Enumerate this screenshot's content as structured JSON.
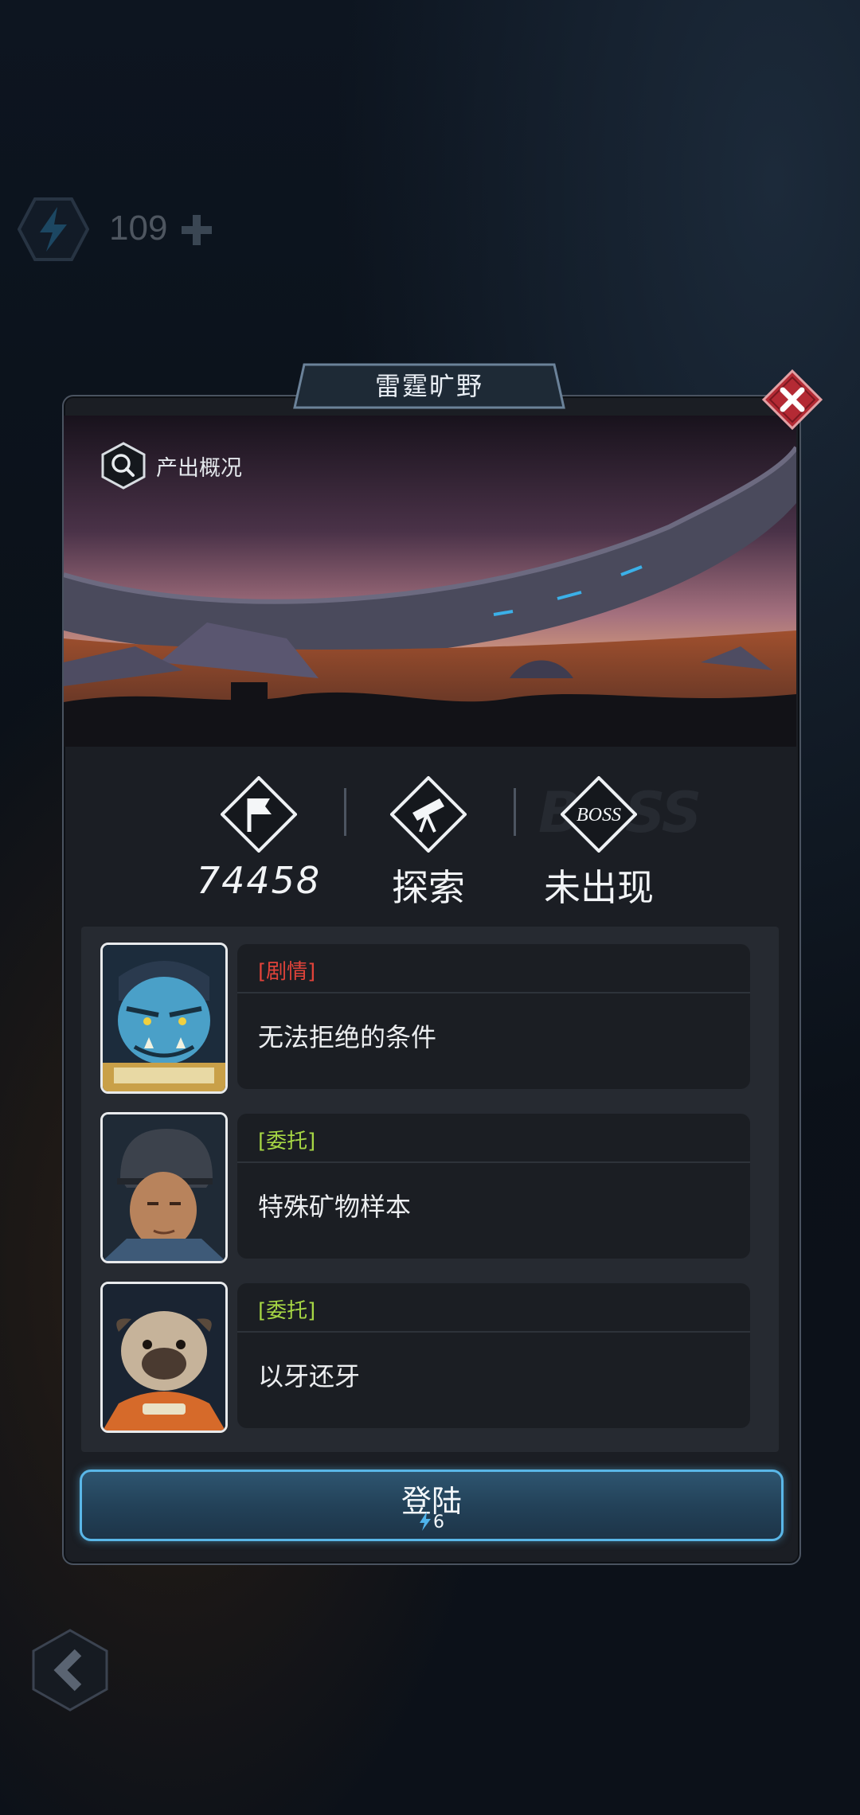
{
  "hud": {
    "energy_value": "109",
    "energy_icon": "lightning-bolt-icon",
    "add_icon": "plus-icon"
  },
  "dialog": {
    "title": "雷霆旷野",
    "yield_label": "产出概况",
    "stats": [
      {
        "icon": "flag-icon",
        "value": "74458"
      },
      {
        "icon": "telescope-icon",
        "value": "探索"
      },
      {
        "icon_text": "BOSS",
        "value": "未出现"
      }
    ],
    "boss_ghost_text": "BOSS",
    "quests": [
      {
        "tag": "[剧情]",
        "title": "无法拒绝的条件",
        "tag_color": "#e0433a",
        "portrait": "blue-orc-character"
      },
      {
        "tag": "[委托]",
        "title": "特殊矿物样本",
        "tag_color": "#a6d644",
        "portrait": "helmeted-soldier-character"
      },
      {
        "tag": "[委托]",
        "title": "以牙还牙",
        "tag_color": "#a6d644",
        "portrait": "pug-astronaut-character"
      }
    ],
    "login": {
      "label": "登陆",
      "cost": "6"
    }
  },
  "colors": {
    "accent_blue": "#5ab7e8",
    "close_red": "#c0303a",
    "story_red": "#e0433a",
    "task_green": "#a6d644"
  }
}
